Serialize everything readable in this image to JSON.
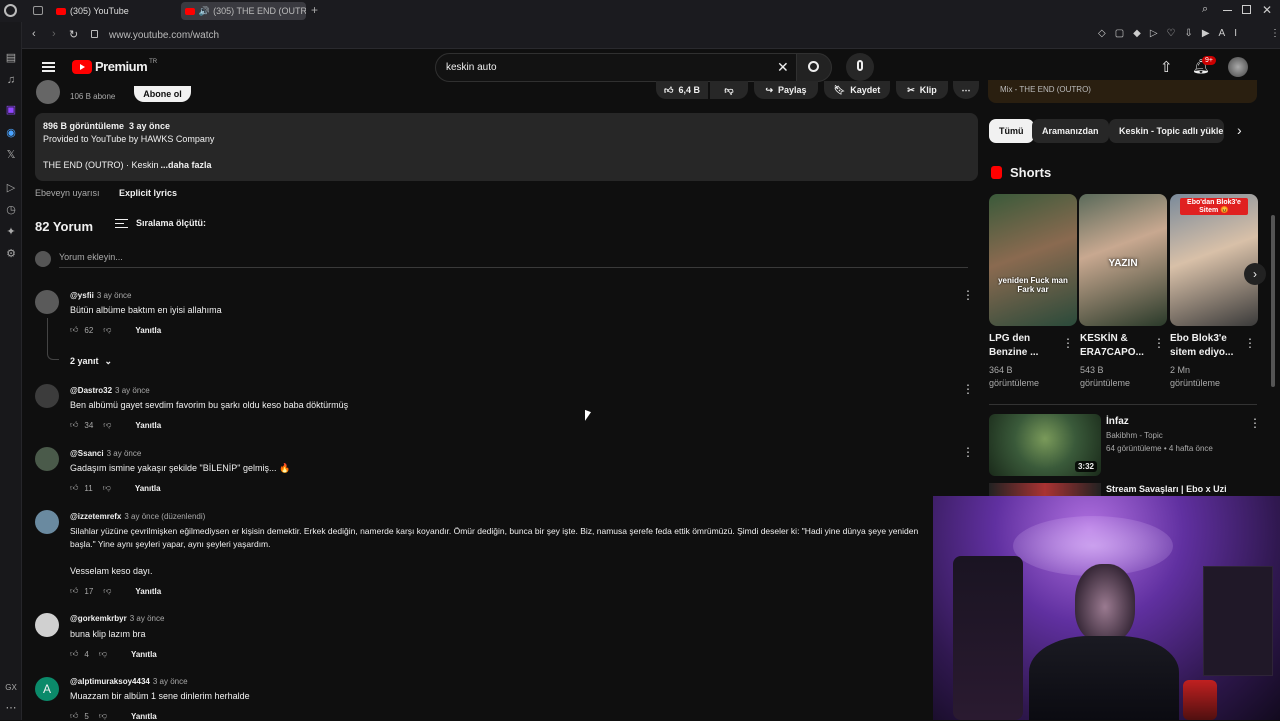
{
  "browser": {
    "tabs": [
      {
        "title": "(305) YouTube"
      },
      {
        "title": "(305) THE END (OUTR"
      }
    ],
    "url": "www.youtube.com/watch"
  },
  "yt": {
    "logo": "Premium",
    "logo_sup": "TR",
    "search_value": "keskin auto",
    "notif_count": "9+"
  },
  "channel": {
    "subs": "106 B abone",
    "subscribe": "Abone ol"
  },
  "actions": {
    "likes": "6,4 B",
    "share": "Paylaş",
    "save": "Kaydet",
    "clip": "Klip"
  },
  "description": {
    "stats": "896 B görüntüleme  3 ay önce",
    "provided": "Provided to YouTube by HAWKS Company",
    "title_line": "THE END (OUTRO) · Keskin",
    "more": "...daha fazla"
  },
  "advisory": {
    "label": "Ebeveyn uyarısı",
    "value": "Explicit lyrics"
  },
  "comments_header": {
    "count": "82 Yorum",
    "sort": "Sıralama ölçütü:",
    "add_placeholder": "Yorum ekleyin..."
  },
  "comments": [
    {
      "user": "@ysfii",
      "time": "3 ay önce",
      "text": "Bütün albüme baktım en iyisi allahıma",
      "likes": "62",
      "reply": "Yanıtla",
      "replies": "2 yanıt"
    },
    {
      "user": "@Dastro32",
      "time": "3 ay önce",
      "text": "Ben albümü gayet sevdim favorim bu şarkı oldu keso baba döktürmüş",
      "likes": "34",
      "reply": "Yanıtla"
    },
    {
      "user": "@Ssanci",
      "time": "3 ay önce",
      "text": "Gadaşım ismine yakaşır şekilde \"BİLENİP\" gelmiş... 🔥",
      "likes": "11",
      "reply": "Yanıtla"
    },
    {
      "user": "@izzetemrefx",
      "time": "3 ay önce (düzenlendi)",
      "text": "Silahlar yüzüne çevrilmişken eğilmediysen er kişisin demektir. Erkek dediğin, namerde karşı koyandır. Ömür dediğin, bunca bir şey işte. Biz, namusa şerefe feda ettik ömrümüzü. Şimdi deseler ki: \"Hadi yine dünya şeye yeniden başla.\" Yine aynı şeyleri yapar, aynı şeyleri yaşardım.",
      "text2": "Vesselam keso dayı.",
      "likes": "17",
      "reply": "Yanıtla"
    },
    {
      "user": "@gorkemkrbyr",
      "time": "3 ay önce",
      "text": "buna klip lazım bra",
      "likes": "4",
      "reply": "Yanıtla"
    },
    {
      "user": "@alptimuraksoy4434",
      "time": "3 ay önce",
      "text": "Muazzam bir albüm 1 sene dinlerim herhalde",
      "likes": "5",
      "reply": "Yanıtla",
      "avatar_letter": "A"
    }
  ],
  "right": {
    "mix_title": "Mix - THE END (OUTRO)",
    "chips": [
      "Tümü",
      "Aramanızdan",
      "Keskin - Topic adlı yükle"
    ],
    "shorts_label": "Shorts",
    "shorts": [
      {
        "title": "LPG den Benzine ...",
        "views": "364 B görüntüleme",
        "overlay": "yeniden Fuck man Fark var"
      },
      {
        "title": "KESKİN & ERA7CAPO...",
        "views": "543 B görüntüleme",
        "overlay": "YAZIN"
      },
      {
        "title": "Ebo Blok3'e sitem ediyo...",
        "views": "2 Mn görüntüleme",
        "overlay": "Ebo'dan Blok3'e Sitem 😡"
      }
    ],
    "videos": [
      {
        "title": "İnfaz",
        "channel": "Bakibhm - Topic",
        "meta": "64 görüntüleme • 4 hafta önce",
        "duration": "3:32"
      },
      {
        "title": "Stream Savaşları | Ebo x Uzi"
      }
    ]
  },
  "colors": {
    "accent_red": "#ff0000",
    "bg": "#0f0f0f",
    "chip": "#272727"
  }
}
